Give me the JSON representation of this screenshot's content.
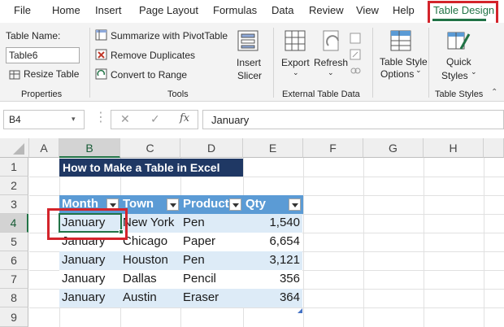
{
  "tabs": [
    "File",
    "Home",
    "Insert",
    "Page Layout",
    "Formulas",
    "Data",
    "Review",
    "View",
    "Help",
    "Table Design"
  ],
  "ribbon": {
    "properties": {
      "table_name_label": "Table Name:",
      "table_name_value": "Table6",
      "resize_label": "Resize Table",
      "group_label": "Properties"
    },
    "tools": {
      "summarize_label": "Summarize with PivotTable",
      "remove_duplicates_label": "Remove Duplicates",
      "convert_label": "Convert to Range",
      "insert_slicer_line1": "Insert",
      "insert_slicer_line2": "Slicer",
      "group_label": "Tools"
    },
    "external": {
      "export_label": "Export",
      "refresh_label": "Refresh",
      "group_label": "External Table Data"
    },
    "styles": {
      "options_line1": "Table Style",
      "options_line2": "Options",
      "quick_line1": "Quick",
      "quick_line2": "Styles",
      "group_label": "Table Styles"
    }
  },
  "formula_bar": {
    "cell_ref": "B4",
    "fx_label": "fx",
    "value": "January"
  },
  "columns": [
    "A",
    "B",
    "C",
    "D",
    "E",
    "F",
    "G",
    "H"
  ],
  "rows": [
    "1",
    "2",
    "3",
    "4",
    "5",
    "6",
    "7",
    "8",
    "9"
  ],
  "sheet": {
    "title": "How to Make a Table in Excel",
    "headers": [
      "Month",
      "Town",
      "Product",
      "Qty"
    ],
    "data": [
      [
        "January",
        "New York",
        "Pen",
        "1,540"
      ],
      [
        "January",
        "Chicago",
        "Paper",
        "6,654"
      ],
      [
        "January",
        "Houston",
        "Pen",
        "3,121"
      ],
      [
        "January",
        "Dallas",
        "Pencil",
        "356"
      ],
      [
        "January",
        "Austin",
        "Eraser",
        "364"
      ]
    ]
  },
  "colors": {
    "accent": "#217346",
    "highlight_red": "#d3242b",
    "table_header": "#5b9bd5",
    "title_fill": "#1f3864",
    "band_fill": "#ddebf7"
  }
}
